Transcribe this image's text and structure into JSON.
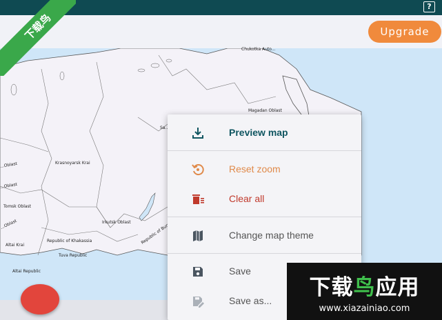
{
  "header": {
    "help_label": "?"
  },
  "toolbar": {
    "upgrade_label": "Upgrade"
  },
  "colors": {
    "topbar": "#0f4a52",
    "upgrade": "#f08a3c",
    "fab": "#e2453c",
    "preview_text": "#0f5560",
    "reset_text": "#e08a4a",
    "clear_text": "#c0392b"
  },
  "map": {
    "regions": [
      "Chukotka Auto...",
      "Magadan Oblast",
      "Krasnoyarsk Krai",
      "Tomsk Oblast",
      "Irkutsk Oblast",
      "Republic of Buryatia",
      "Tuva Republic",
      "Altai Krai",
      "Altai Republic",
      "Republic of Khakassia",
      "Sa...",
      "...Oblast",
      "...Oblast",
      "...Oblast"
    ]
  },
  "menu": {
    "items": [
      {
        "label": "Preview map",
        "icon": "download-icon"
      },
      {
        "label": "Reset zoom",
        "icon": "reset-zoom-icon"
      },
      {
        "label": "Clear all",
        "icon": "clear-all-icon"
      },
      {
        "label": "Change map theme",
        "icon": "map-icon"
      },
      {
        "label": "Save",
        "icon": "save-icon"
      },
      {
        "label": "Save as...",
        "icon": "save-as-icon"
      }
    ]
  },
  "badge": {
    "text": "下载鸟"
  },
  "watermark": {
    "title_white": "下载",
    "title_accent": "鸟",
    "title_rest": "应用",
    "url": "www.xiazainiao.com"
  }
}
